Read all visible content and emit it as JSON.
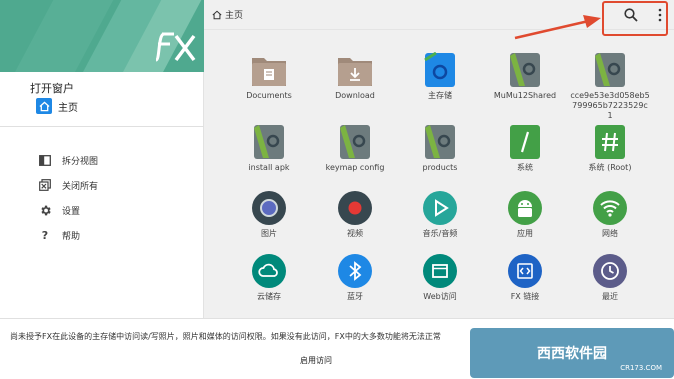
{
  "sidebar": {
    "section_title": "打开窗户",
    "home_label": "主页",
    "actions": [
      {
        "label": "拆分视图",
        "icon": "split-view-icon"
      },
      {
        "label": "关闭所有",
        "icon": "close-all-icon"
      },
      {
        "label": "设置",
        "icon": "gear-icon"
      },
      {
        "label": "帮助",
        "icon": "help-icon"
      }
    ]
  },
  "topbar": {
    "breadcrumb": "主页"
  },
  "tiles": [
    {
      "label": "Documents",
      "icon": "documents-folder-icon"
    },
    {
      "label": "Download",
      "icon": "download-folder-icon"
    },
    {
      "label": "主存储",
      "icon": "main-storage-icon"
    },
    {
      "label": "MuMu12Shared",
      "icon": "folder-icon"
    },
    {
      "label": "cce9e53e3d058eb5799965b7223529c1",
      "icon": "folder-icon"
    },
    {
      "label": "install apk",
      "icon": "folder-icon"
    },
    {
      "label": "keymap config",
      "icon": "folder-icon"
    },
    {
      "label": "products",
      "icon": "folder-icon"
    },
    {
      "label": "系统",
      "icon": "system-root-icon"
    },
    {
      "label": "系统 (Root)",
      "icon": "root-hash-icon"
    },
    {
      "label": "图片",
      "icon": "pictures-icon"
    },
    {
      "label": "视频",
      "icon": "video-icon"
    },
    {
      "label": "音乐/音频",
      "icon": "music-icon"
    },
    {
      "label": "应用",
      "icon": "android-icon"
    },
    {
      "label": "网络",
      "icon": "wifi-icon"
    },
    {
      "label": "云储存",
      "icon": "cloud-icon"
    },
    {
      "label": "蓝牙",
      "icon": "bluetooth-icon"
    },
    {
      "label": "Web访问",
      "icon": "web-access-icon"
    },
    {
      "label": "FX 链接",
      "icon": "fx-link-icon"
    },
    {
      "label": "最近",
      "icon": "recent-clock-icon"
    }
  ],
  "notice": {
    "text": "尚未授予FX在此设备的主存储中访问读/写照片，照片和媒体的访问权限。如果没有此访问，FX中的大多数功能将无法正常",
    "button_label": "启用访问"
  },
  "watermark": {
    "text": "西西软件园",
    "sub": "CR173.COM"
  },
  "colors": {
    "accent": "#4fa98f",
    "highlight": "#e04a2f",
    "folder_brown": "#a08a7a"
  }
}
